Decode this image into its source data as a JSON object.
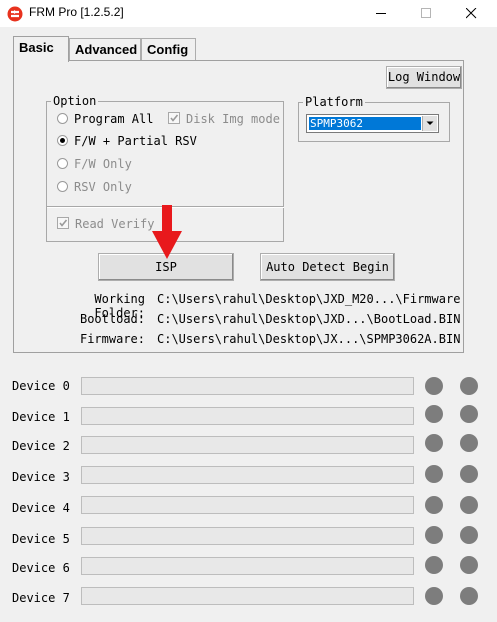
{
  "window": {
    "title": "FRM Pro [1.2.5.2]"
  },
  "tabs": [
    "Basic",
    "Advanced",
    "Config"
  ],
  "log_window_button": "Log Window",
  "option_group": {
    "legend": "Option",
    "program_all": "Program All",
    "disk_img_mode": "Disk Img mode",
    "fw_partial_rsv": "F/W + Partial RSV",
    "fw_only": "F/W Only",
    "rsv_only": "RSV Only",
    "read_verify": "Read Verify"
  },
  "platform_group": {
    "legend": "Platform",
    "selected": "SPMP3062"
  },
  "buttons": {
    "isp": "ISP",
    "auto_detect": "Auto Detect Begin"
  },
  "info": {
    "working_folder_label": "Working Folder:",
    "working_folder_value": "C:\\Users\\rahul\\Desktop\\JXD_M20...\\Firmware",
    "bootload_label": "Bootload:",
    "bootload_value": "C:\\Users\\rahul\\Desktop\\JXD...\\BootLoad.BIN",
    "firmware_label": "Firmware:",
    "firmware_value": "C:\\Users\\rahul\\Desktop\\JX...\\SPMP3062A.BIN"
  },
  "devices": [
    "Device 0",
    "Device 1",
    "Device 2",
    "Device 3",
    "Device 4",
    "Device 5",
    "Device 6",
    "Device 7"
  ],
  "colors": {
    "accent": "#0078d7",
    "app_icon": "#e8321e",
    "arrow": "#e8191c",
    "led": "#7d7d7d"
  }
}
